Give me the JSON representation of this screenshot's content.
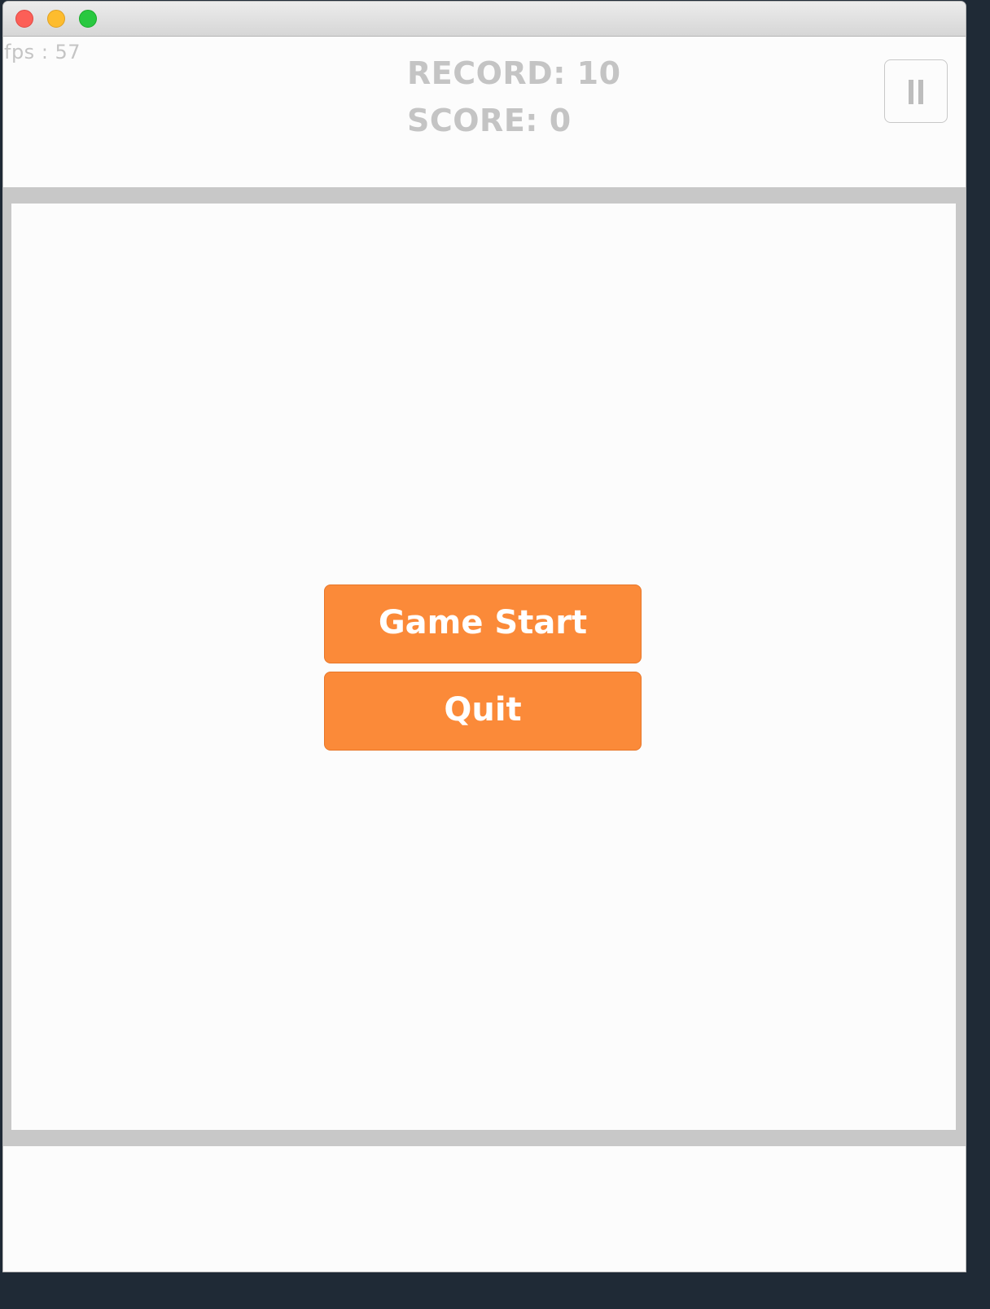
{
  "window": {
    "traffic_lights": [
      "close",
      "minimize",
      "zoom"
    ],
    "colors": {
      "close": "#fc5f57",
      "minimize": "#fdbc2e",
      "zoom": "#29c840"
    }
  },
  "hud": {
    "fps_text": "fps : 57",
    "record_text": "RECORD: 10",
    "score_text": "SCORE: 0",
    "pause_icon": "pause-icon",
    "text_color": "#c4c4c4"
  },
  "menu": {
    "start_label": "Game Start",
    "quit_label": "Quit",
    "button_color": "#fb8a39"
  }
}
